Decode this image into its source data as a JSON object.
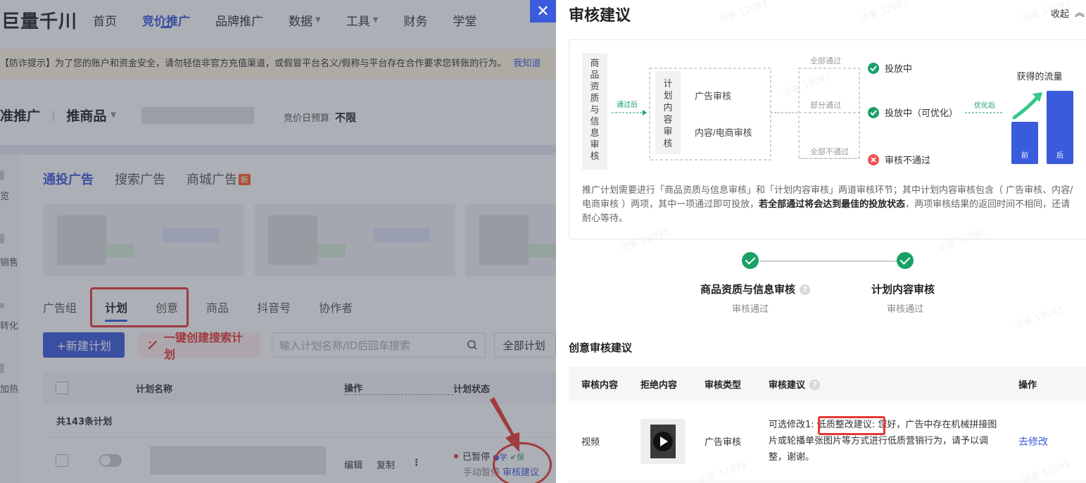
{
  "nav": {
    "logo": "巨量千川",
    "items": [
      "首页",
      "竞价推广",
      "品牌推广",
      "数据",
      "工具",
      "财务",
      "学堂"
    ],
    "active_index": 1,
    "dropdown_indices": [
      3,
      4
    ]
  },
  "notice": {
    "text": "【防诈提示】为了您的账户和资金安全，请勿轻信非官方充值渠道，或假冒平台名义/假称与平台存在合作要求您转账的行为。",
    "link": "我知道"
  },
  "context": {
    "left": "准推广",
    "product": "推商品",
    "budget_label": "竞价日预算",
    "budget_value": "不限"
  },
  "sidebar_labels": [
    "览",
    "销售",
    "转化",
    "加热"
  ],
  "ad_tabs": {
    "items": [
      "通投广告",
      "搜索广告",
      "商城广告"
    ],
    "new_badge": "新"
  },
  "sub_tabs": [
    "广告组",
    "计划",
    "创意",
    "商品",
    "抖音号",
    "协作者"
  ],
  "toolbar": {
    "new_plan": "+新建计划",
    "one_click": "一键创建搜索计划",
    "search_placeholder": "输入计划名称/ID后回车搜索",
    "filter_all": "全部计划"
  },
  "table": {
    "col_name": "计划名称",
    "col_action": "操作",
    "col_status": "计划状态",
    "count": "共143条计划",
    "row": {
      "edit": "编辑",
      "copy": "复制",
      "more": "⋮",
      "status": "已暂停",
      "tag_learn": "学",
      "tag_protect": "保",
      "sub_status": "手动暂停",
      "review_link": "审核建议"
    }
  },
  "drawer": {
    "title": "审核建议",
    "collapse": "收起",
    "flow": {
      "first_stage": "商品资质与信息审核",
      "after_pass": "通过后",
      "plan_stage": "计划内容审核",
      "ad_review": "广告审核",
      "content_review": "内容/电商审核",
      "branch_all": "全部通过",
      "branch_part": "部分通过",
      "branch_none": "全部不通过",
      "result_all": "投放中",
      "result_part": "投放中（可优化）",
      "result_none": "审核不通过",
      "optimize": "优化后",
      "traffic": "获得的流量",
      "before": "前",
      "after": "后"
    },
    "desc_1": "推广计划需要进行「商品资质与信息审核」和「计划内容审核」两道审核环节；其中计划内容审核包含（ 广告审核、内容/电商审核 ）两项，其中一项通过即可投放，",
    "desc_bold": "若全部通过将会达到最佳的投放状态",
    "desc_2": "，两项审核结果的返回时间不相同，还请耐心等待。",
    "steps": [
      {
        "name": "商品资质与信息审核",
        "status": "审核通过"
      },
      {
        "name": "计划内容审核",
        "status": "审核通过"
      }
    ],
    "section_title": "创意审核建议",
    "review_table": {
      "headers": [
        "审核内容",
        "拒绝内容",
        "审核类型",
        "审核建议",
        "操作"
      ],
      "row": {
        "content": "视频",
        "type": "广告审核",
        "suggest_prefix": "可选修改1: ",
        "suggest_highlight": "低质整改建议:",
        "suggest_text": " 您好，广告中存在机械拼接图片或轮播单张图片等方式进行低质营销行为，请予以调整，谢谢。",
        "action": "去修改"
      }
    },
    "watermark": "访客 12093"
  },
  "colors": {
    "brand": "#3a5bdb",
    "success": "#1aa166",
    "danger": "#e53935",
    "notice_bg": "#fff8e1"
  }
}
